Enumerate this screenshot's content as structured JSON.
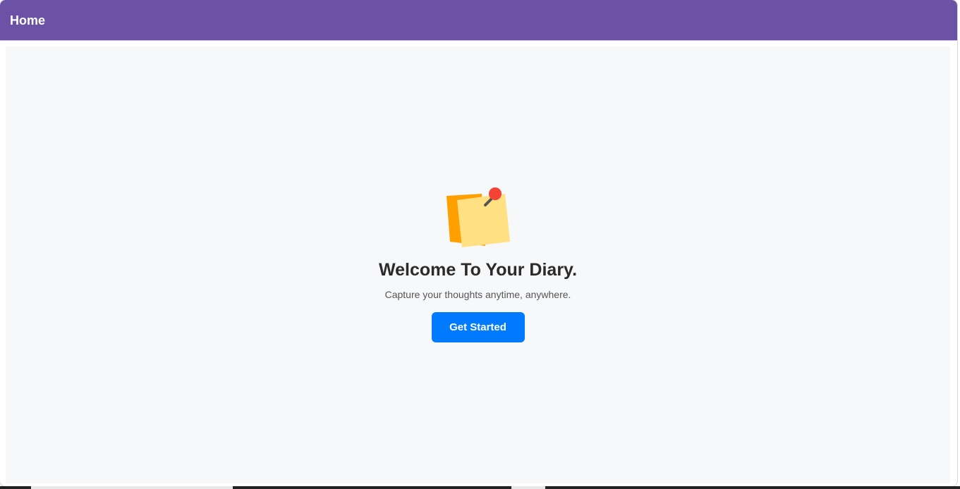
{
  "header": {
    "title": "Home",
    "background_color": "#6b52a6"
  },
  "main": {
    "illustration_icon": "sticky-note-pin-icon",
    "welcome_title": "Welcome To Your Diary.",
    "welcome_subtitle": "Capture your thoughts anytime, anywhere.",
    "get_started_label": "Get Started",
    "button_color": "#007bff",
    "panel_color": "#f7f8fa"
  }
}
